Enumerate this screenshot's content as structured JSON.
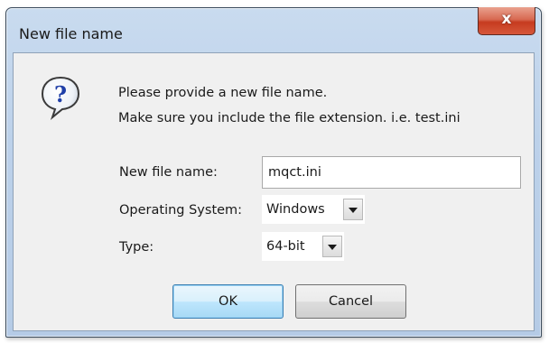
{
  "window": {
    "title": "New file name",
    "close_glyph": "x"
  },
  "message": {
    "icon": "question-icon",
    "line1": "Please provide a new file name.",
    "line2": "Make sure you include the file extension. i.e. test.ini"
  },
  "form": {
    "file_name_label": "New file name:",
    "file_name_value": "mqct.ini",
    "os_label": "Operating System:",
    "os_value": "Windows",
    "type_label": "Type:",
    "type_value": "64-bit"
  },
  "buttons": {
    "ok_label": "OK",
    "cancel_label": "Cancel"
  },
  "colors": {
    "close_button": "#c63b1f",
    "ok_button_border": "#3c7fb1",
    "icon_blue": "#1f3fa8"
  }
}
